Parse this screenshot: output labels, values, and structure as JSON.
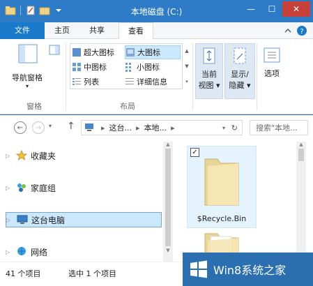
{
  "window": {
    "title": "本地磁盘 (C:)"
  },
  "tabs": {
    "file": "文件",
    "home": "主页",
    "share": "共享",
    "view": "查看"
  },
  "ribbon": {
    "nav_pane": {
      "label": "导航窗格",
      "group": "窗格"
    },
    "layout": {
      "group": "布局",
      "items": [
        "超大图标",
        "大图标",
        "中图标",
        "小图标",
        "列表",
        "详细信息"
      ],
      "selected": "大图标"
    },
    "current_view": {
      "label_line1": "当前",
      "label_line2": "视图"
    },
    "show_hide": {
      "label_line1": "显示/",
      "label_line2": "隐藏"
    },
    "options": {
      "label": "选项"
    }
  },
  "address": {
    "crumbs": [
      "这台...",
      "本地..."
    ],
    "search_placeholder": "搜索\"本地..."
  },
  "nav_pane": {
    "items": [
      {
        "label": "收藏夹",
        "icon": "star-icon"
      },
      {
        "label": "家庭组",
        "icon": "homegroup-icon"
      },
      {
        "label": "这台电脑",
        "icon": "computer-icon"
      },
      {
        "label": "网络",
        "icon": "network-icon"
      }
    ],
    "selected": "这台电脑"
  },
  "files": [
    {
      "name": "$Recycle.Bin",
      "checked": true
    },
    {
      "name": "",
      "checked": false
    }
  ],
  "status": {
    "count": "41 个项目",
    "selection": "选中 1 个项目"
  },
  "watermark": {
    "text": "Win8系统之家"
  }
}
